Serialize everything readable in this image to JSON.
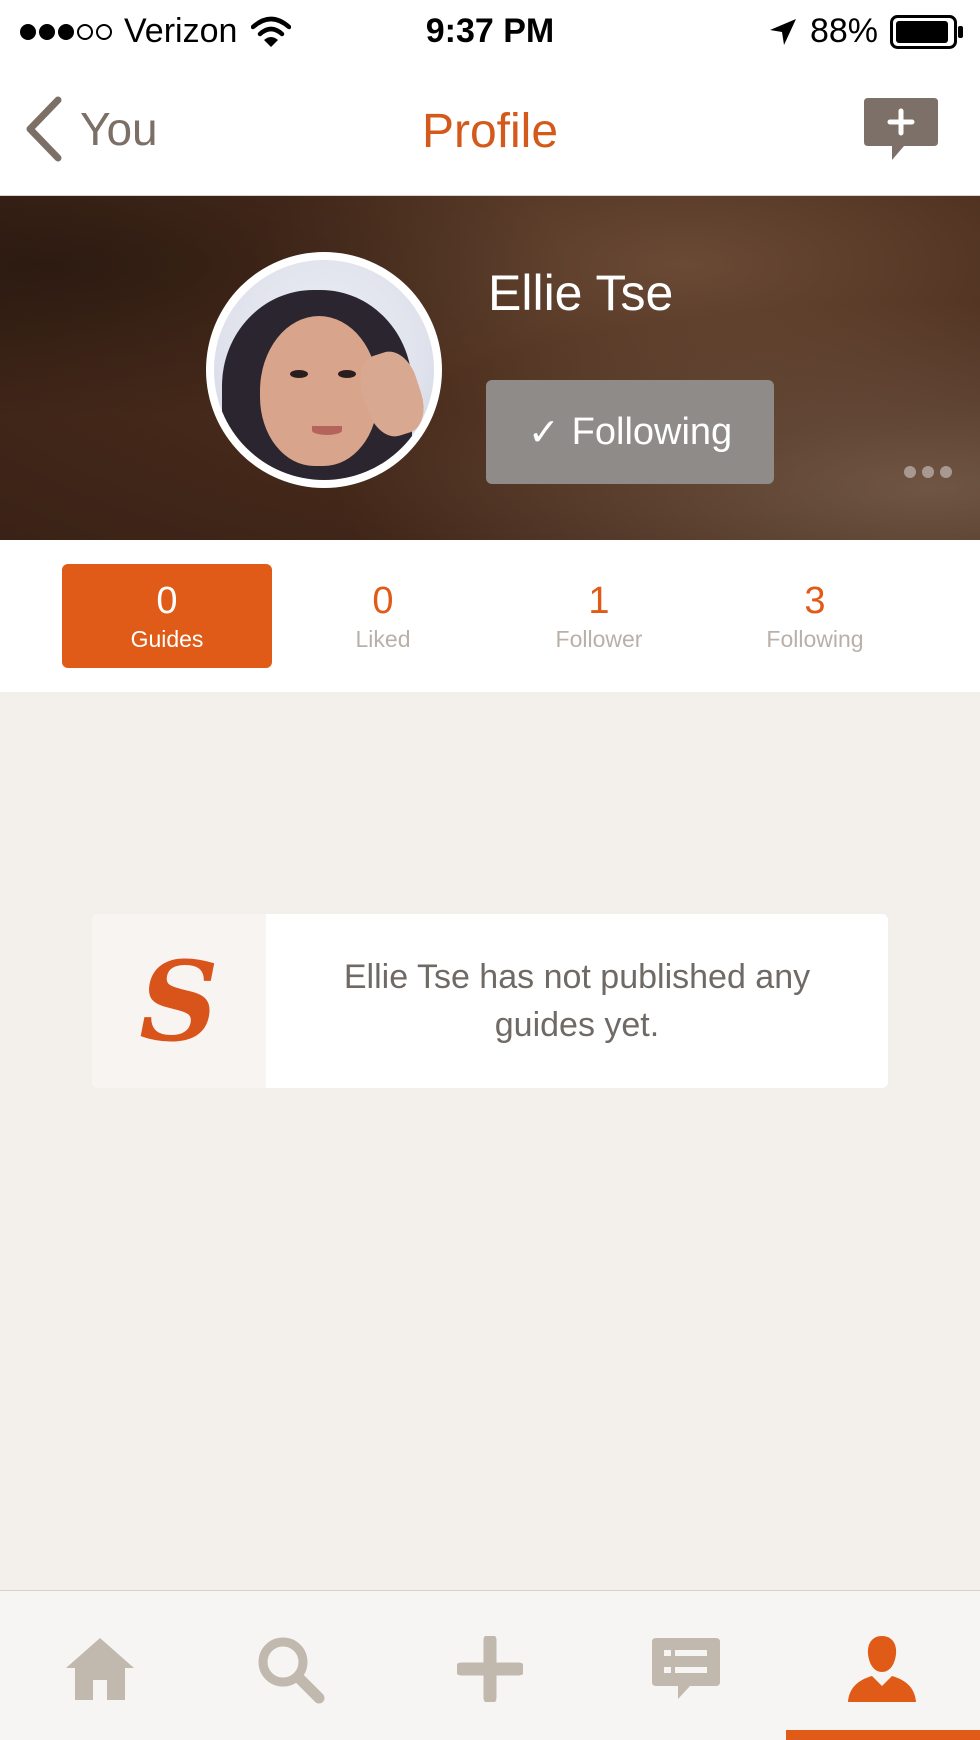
{
  "status_bar": {
    "carrier": "Verizon",
    "time": "9:37 PM",
    "battery": "88%",
    "signal_bars_filled": 3,
    "signal_bars_total": 5
  },
  "nav": {
    "back_label": "You",
    "title": "Profile",
    "compose_icon": "add-comment-icon"
  },
  "profile": {
    "name": "Ellie Tse",
    "follow_button_label": "Following",
    "follow_check": "✓"
  },
  "stats": [
    {
      "value": "0",
      "label": "Guides",
      "active": true
    },
    {
      "value": "0",
      "label": "Liked",
      "active": false
    },
    {
      "value": "1",
      "label": "Follower",
      "active": false
    },
    {
      "value": "3",
      "label": "Following",
      "active": false
    }
  ],
  "empty_state": {
    "logo_letter": "S",
    "message": "Ellie Tse has not published any guides yet."
  },
  "tab_bar": {
    "tabs": [
      "home-icon",
      "search-icon",
      "plus-icon",
      "messages-icon",
      "profile-icon"
    ],
    "active_index": 4
  },
  "colors": {
    "accent": "#df5b17",
    "muted_text": "#b9b1a9",
    "icon_gray": "#c1b8ae"
  }
}
